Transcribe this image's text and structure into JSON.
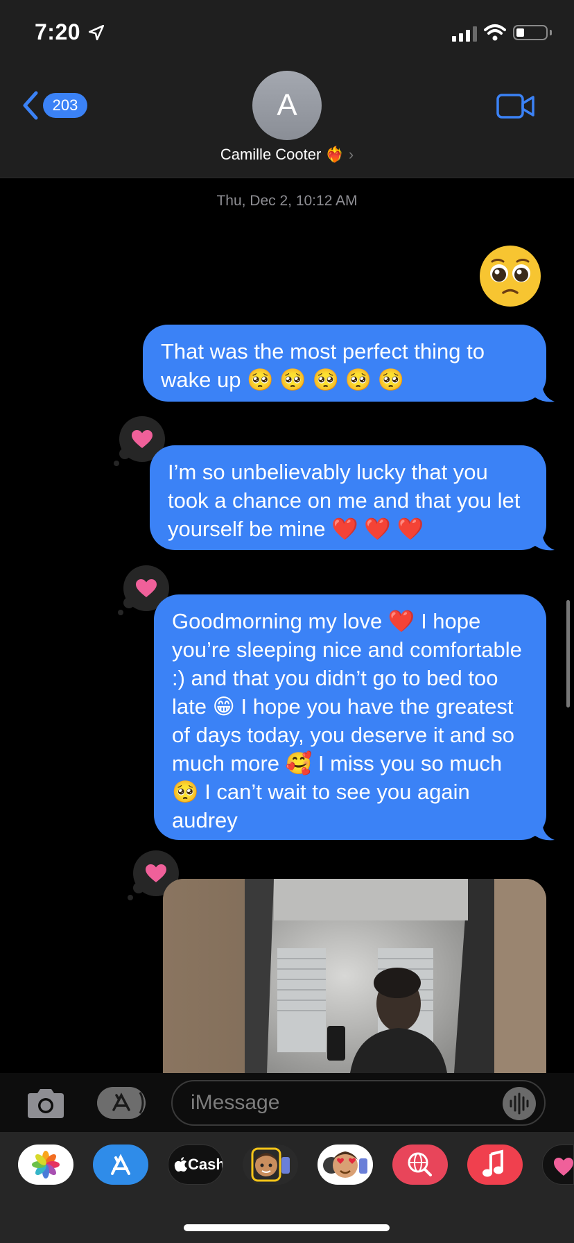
{
  "status_bar": {
    "time": "7:20"
  },
  "header": {
    "back_count": "203",
    "avatar_initial": "A",
    "contact_name": "Camille Cooter ❤️‍🔥",
    "chevron": "›"
  },
  "conversation": {
    "timestamp": "Thu, Dec 2, 10:12 AM",
    "big_emoji": "🥺",
    "messages": [
      {
        "text": "That was the most perfect thing to wake up 🥺 🥺 🥺 🥺 🥺",
        "reaction": ""
      },
      {
        "text": "I’m so unbelievably lucky that you took a chance on me and that you let yourself be mine ❤️ ❤️ ❤️",
        "reaction": "heart"
      },
      {
        "text": "Goodmorning my love ❤️ I hope you’re sleeping nice and comfortable :) and that you didn’t go to bed too late 😁 I hope you have the greatest of days today, you deserve it and so much more 🥰 I miss you so much 🥺 I can’t wait to see you again audrey",
        "reaction": "heart"
      },
      {
        "text": "",
        "reaction": "heart",
        "type": "photo"
      }
    ]
  },
  "composer": {
    "placeholder": "iMessage"
  },
  "app_tray": {
    "apps": [
      {
        "name": "photos-app",
        "label": ""
      },
      {
        "name": "app-store-app",
        "label": ""
      },
      {
        "name": "apple-cash-app",
        "label": "Cash"
      },
      {
        "name": "memoji-stickers-app",
        "label": ""
      },
      {
        "name": "animoji-app",
        "label": ""
      },
      {
        "name": "image-search-app",
        "label": ""
      },
      {
        "name": "music-app",
        "label": ""
      },
      {
        "name": "digital-touch-app",
        "label": ""
      }
    ]
  },
  "colors": {
    "bubble": "#3b82f6",
    "header_bg": "#1f1f1f",
    "tapback_heart": "#f0609a"
  }
}
